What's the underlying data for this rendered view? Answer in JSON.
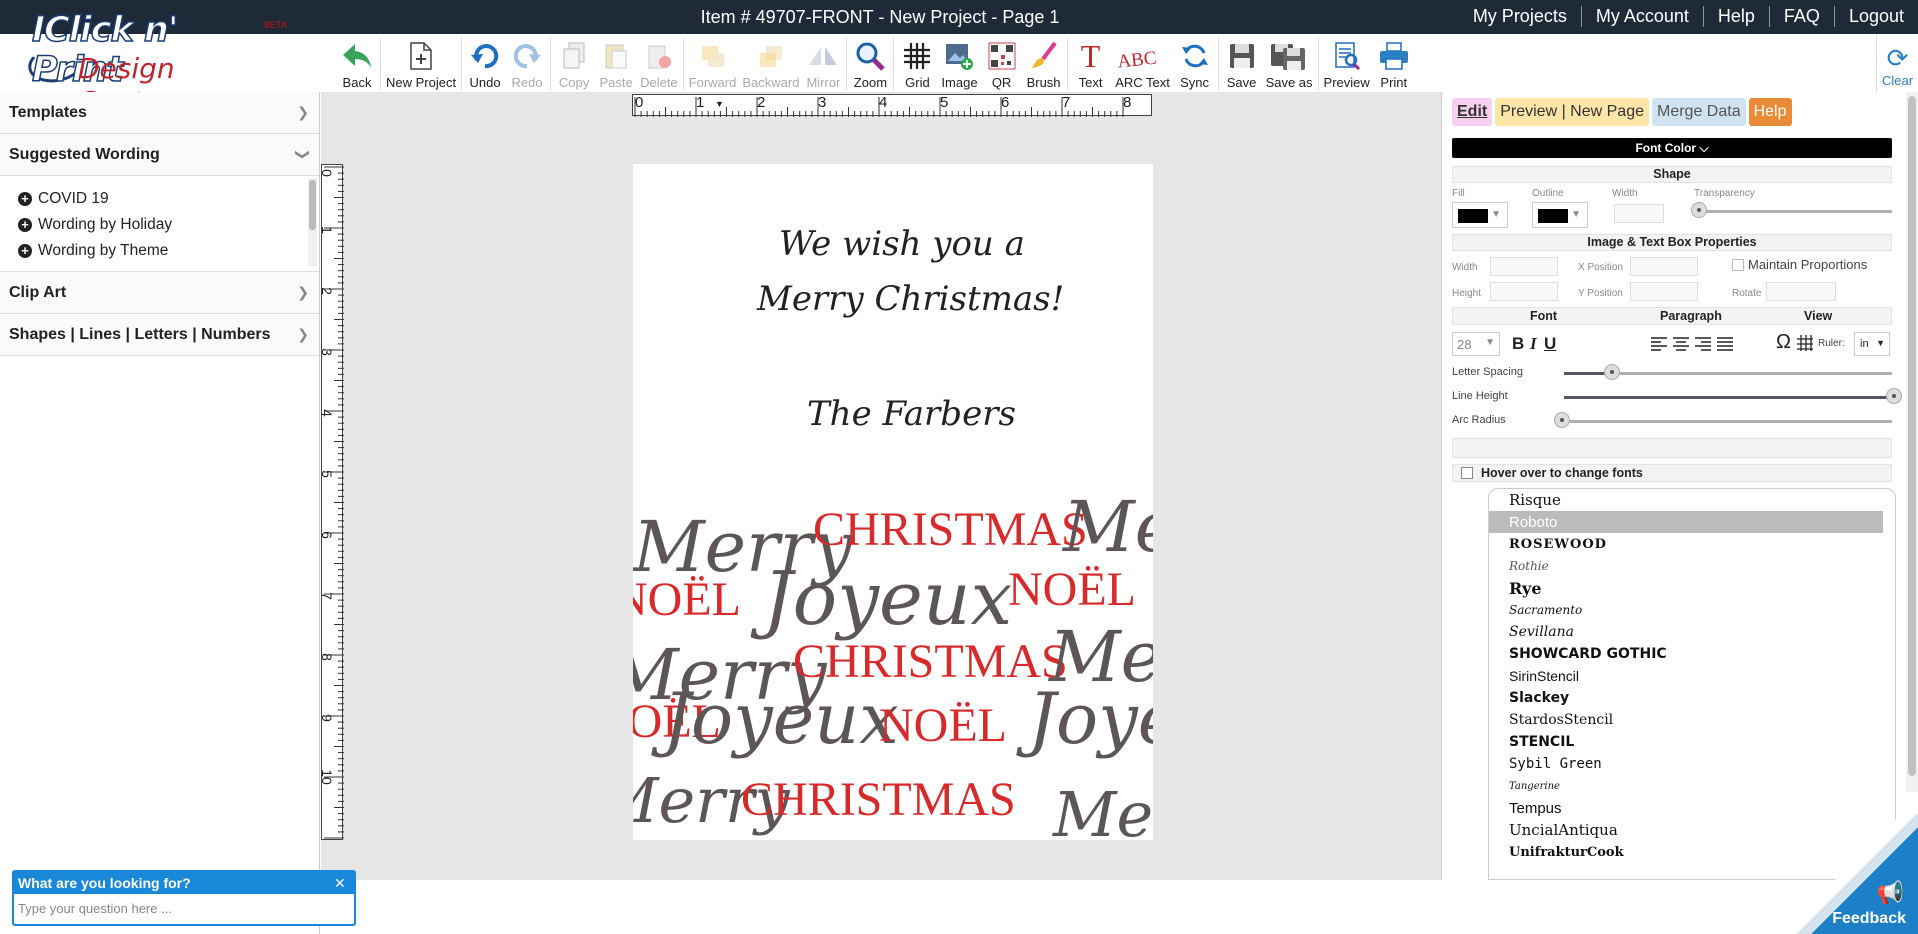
{
  "app": {
    "item_title": "Item # 49707-FRONT - New Project - Page 1",
    "logo_main": "IClick n' Print",
    "logo_sub": "Design Center",
    "logo_beta": "BETA"
  },
  "topnav": [
    "My Projects",
    "My Account",
    "Help",
    "FAQ",
    "Logout"
  ],
  "toolbar": [
    {
      "label": "Back",
      "icon": "back-arrow-icon",
      "disabled": false
    },
    {
      "label": "New Project",
      "icon": "new-page-icon",
      "disabled": false
    },
    {
      "label": "Undo",
      "icon": "undo-icon",
      "disabled": false
    },
    {
      "label": "Redo",
      "icon": "redo-icon",
      "disabled": true
    },
    {
      "label": "Copy",
      "icon": "copy-icon",
      "disabled": true
    },
    {
      "label": "Paste",
      "icon": "paste-icon",
      "disabled": true
    },
    {
      "label": "Delete",
      "icon": "delete-icon",
      "disabled": true
    },
    {
      "label": "Forward",
      "icon": "forward-icon",
      "disabled": true
    },
    {
      "label": "Backward",
      "icon": "backward-icon",
      "disabled": true
    },
    {
      "label": "Mirror",
      "icon": "mirror-icon",
      "disabled": true
    },
    {
      "label": "Zoom",
      "icon": "zoom-icon",
      "disabled": false
    },
    {
      "label": "Grid",
      "icon": "grid-icon",
      "disabled": false
    },
    {
      "label": "Image",
      "icon": "image-icon",
      "disabled": false
    },
    {
      "label": "QR",
      "icon": "qr-icon",
      "disabled": false
    },
    {
      "label": "Brush",
      "icon": "brush-icon",
      "disabled": false
    },
    {
      "label": "Text",
      "icon": "text-icon",
      "disabled": false
    },
    {
      "label": "ARC Text",
      "icon": "arc-text-icon",
      "disabled": false
    },
    {
      "label": "Sync",
      "icon": "sync-icon",
      "disabled": false
    },
    {
      "label": "Save",
      "icon": "save-icon",
      "disabled": false
    },
    {
      "label": "Save as",
      "icon": "save-as-icon",
      "disabled": false
    },
    {
      "label": "Preview",
      "icon": "preview-icon",
      "disabled": false
    },
    {
      "label": "Print",
      "icon": "print-icon",
      "disabled": false
    }
  ],
  "clear_label": "Clear",
  "left_panel": {
    "templates": "Templates",
    "suggested_wording": "Suggested Wording",
    "wording_items": [
      "COVID 19",
      "Wording by Holiday",
      "Wording by Theme"
    ],
    "clip_art": "Clip Art",
    "shapes": "Shapes | Lines | Letters | Numbers"
  },
  "rulers": {
    "horizontal": [
      "0",
      "1",
      "2",
      "3",
      "4",
      "5",
      "6",
      "7",
      "8"
    ],
    "vertical": [
      "0",
      "1",
      "2",
      "3",
      "4",
      "5",
      "6",
      "7",
      "8",
      "9",
      "10"
    ]
  },
  "card": {
    "line1": "We wish you a",
    "line2": "Merry Christmas!",
    "signature": "The Farbers",
    "pattern_words": [
      "Merry",
      "CHRISTMAS",
      "NOËL",
      "Joyeux"
    ]
  },
  "right_panel": {
    "tabs": [
      {
        "label": "Edit",
        "bg": "#f6d0f0"
      },
      {
        "label": "Preview | New Page",
        "bg": "#fbe6a8"
      },
      {
        "label": "Merge Data",
        "bg": "#cfe3f0"
      },
      {
        "label": "Help",
        "bg": "#e98a36"
      }
    ],
    "font_color_button": "Font Color",
    "shape_section": "Shape",
    "shape_labels": {
      "fill": "Fill",
      "outline": "Outline",
      "width": "Width",
      "transparency": "Transparency"
    },
    "image_text_section": "Image & Text Box Properties",
    "box_labels": {
      "width": "Width",
      "height": "Height",
      "x": "X Position",
      "y": "Y Position",
      "rotate": "Rotate",
      "maintain": "Maintain Proportions"
    },
    "font_head": "Font",
    "paragraph_head": "Paragraph",
    "view_head": "View",
    "font_size": "28",
    "ruler_label": "Ruler:",
    "ruler_unit": "in",
    "letter_spacing": "Letter Spacing",
    "line_height": "Line Height",
    "arc_radius": "Arc Radius",
    "hover_label": "Hover over to change fonts",
    "fonts": [
      "Risque",
      "Roboto",
      "ROSEWOOD",
      "Rothie",
      "Rye",
      "Sacramento",
      "Sevillana",
      "SHOWCARD GOTHIC",
      "SirinStencil",
      "Slackey",
      "StardosStencil",
      "STENCIL",
      "Sybil Green",
      "Tangerine",
      "Tempus",
      "UncialAntiqua",
      "UnifrakturCook"
    ],
    "selected_font": "Roboto"
  },
  "chat": {
    "title": "What are you looking for?",
    "placeholder": "Type your question here ..."
  },
  "feedback_label": "Feedback"
}
